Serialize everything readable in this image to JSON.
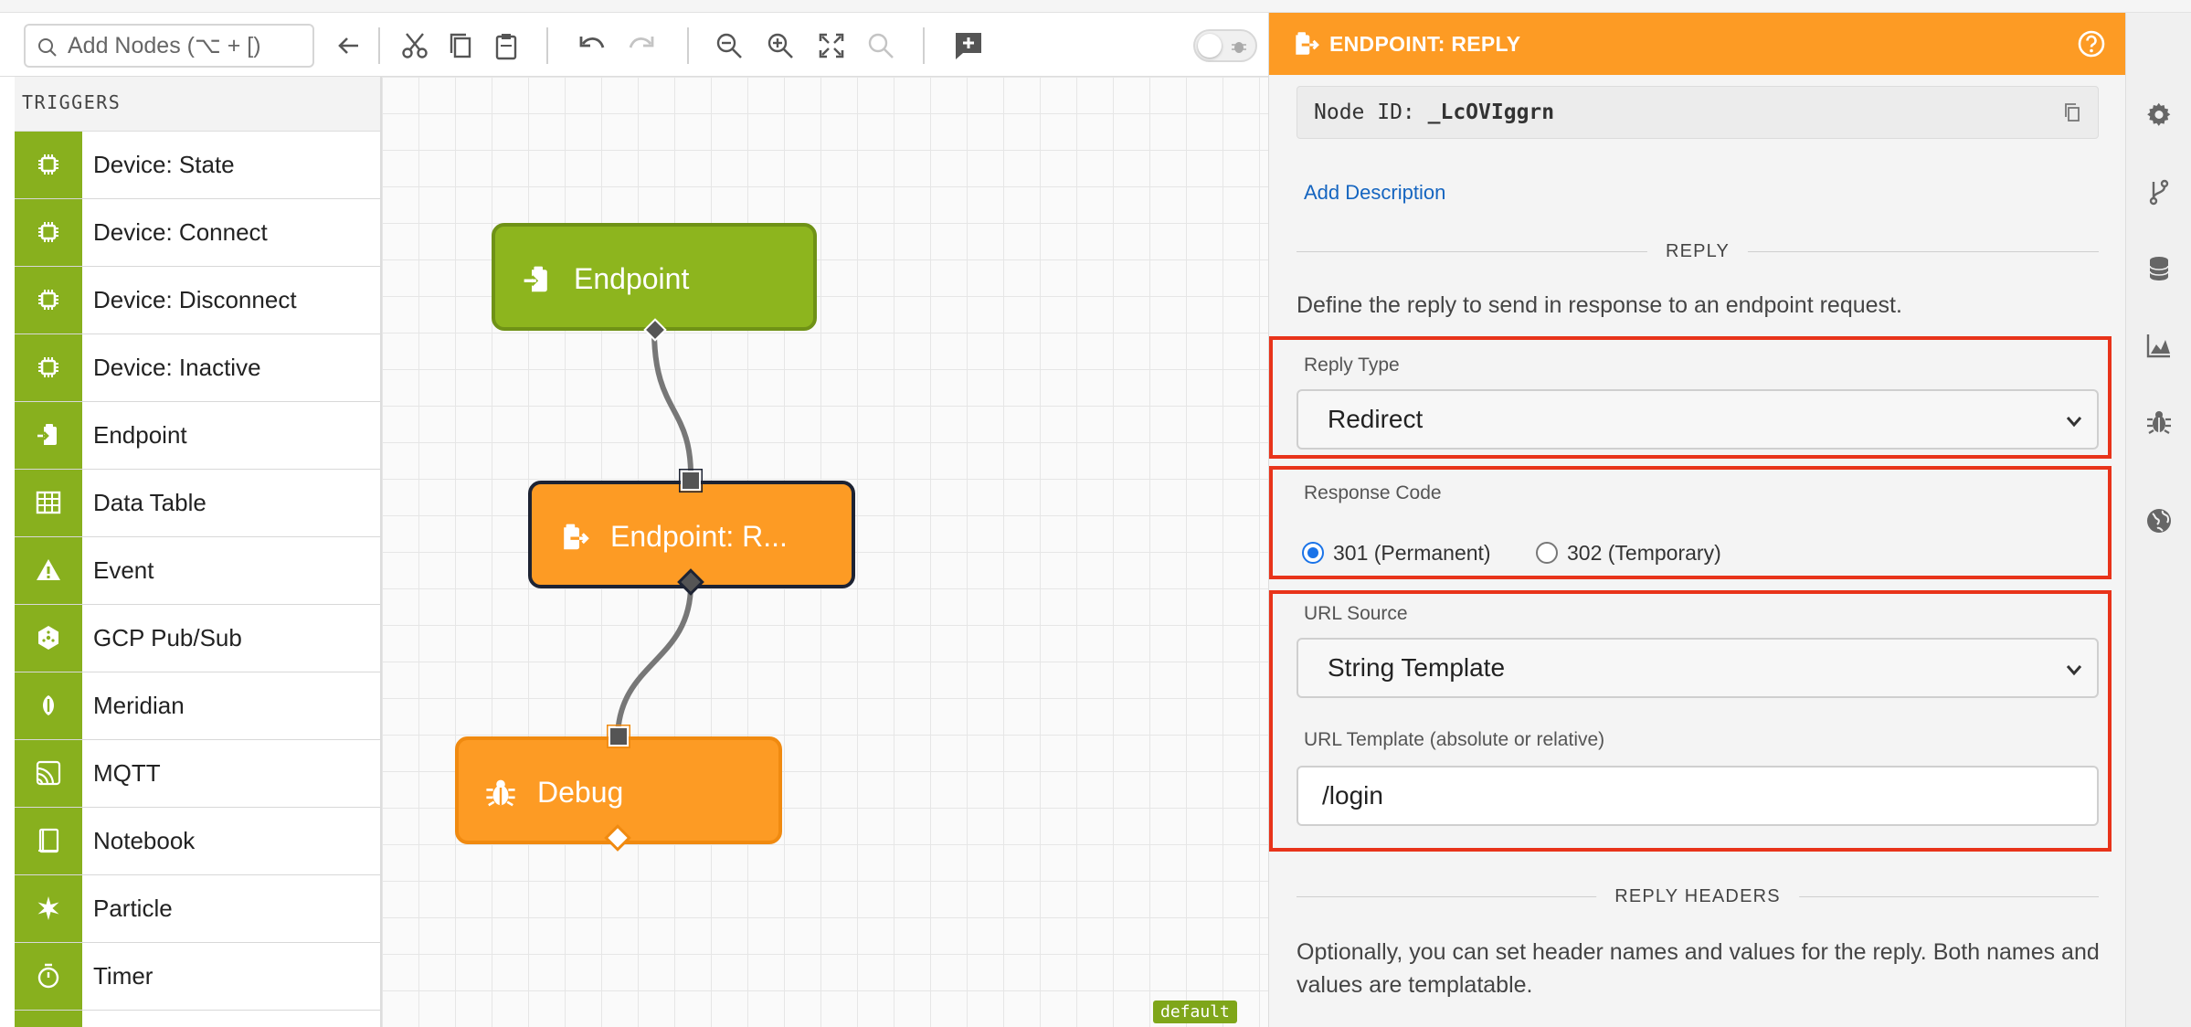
{
  "toolbar": {
    "search_placeholder": "Add Nodes (⌥ + [)"
  },
  "palette": {
    "title": "TRIGGERS",
    "items": [
      {
        "label": "Device: State",
        "icon": "chip-icon"
      },
      {
        "label": "Device: Connect",
        "icon": "chip-icon"
      },
      {
        "label": "Device: Disconnect",
        "icon": "chip-icon"
      },
      {
        "label": "Device: Inactive",
        "icon": "chip-icon"
      },
      {
        "label": "Endpoint",
        "icon": "endpoint-icon"
      },
      {
        "label": "Data Table",
        "icon": "table-icon"
      },
      {
        "label": "Event",
        "icon": "warning-icon"
      },
      {
        "label": "GCP Pub/Sub",
        "icon": "gcp-icon"
      },
      {
        "label": "Meridian",
        "icon": "meridian-icon"
      },
      {
        "label": "MQTT",
        "icon": "mqtt-icon"
      },
      {
        "label": "Notebook",
        "icon": "notebook-icon"
      },
      {
        "label": "Particle",
        "icon": "particle-icon"
      },
      {
        "label": "Timer",
        "icon": "timer-icon"
      }
    ],
    "accent": "#88b01e"
  },
  "canvas": {
    "nodes": [
      {
        "label": "Endpoint",
        "color": "#8db51e"
      },
      {
        "label": "Endpoint: R...",
        "color": "#fd9b24"
      },
      {
        "label": "Debug",
        "color": "#fd9b24"
      }
    ],
    "env_badge": "default"
  },
  "panel": {
    "title": "ENDPOINT: REPLY",
    "node_id_label": "Node ID:",
    "node_id_value": "_LcOVIggrn",
    "add_description": "Add Description",
    "section_reply": "REPLY",
    "reply_description": "Define the reply to send in response to an endpoint request.",
    "reply_type_label": "Reply Type",
    "reply_type_value": "Redirect",
    "response_code_label": "Response Code",
    "response_code_options": [
      "301 (Permanent)",
      "302 (Temporary)"
    ],
    "response_code_selected": "301 (Permanent)",
    "url_source_label": "URL Source",
    "url_source_value": "String Template",
    "url_template_label": "URL Template (absolute or relative)",
    "url_template_value": "/login",
    "section_headers": "REPLY HEADERS",
    "headers_description": "Optionally, you can set header names and values for the reply. Both names and values are templatable.",
    "header_color": "#fd9b24",
    "highlight_color": "#e8331a"
  },
  "rail": {
    "icons": [
      "gear-icon",
      "branch-icon",
      "database-icon",
      "chart-icon",
      "bug-icon",
      "globe-icon"
    ]
  }
}
